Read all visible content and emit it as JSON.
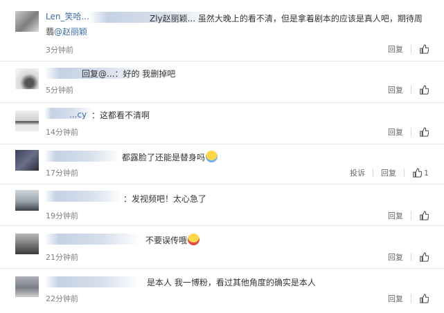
{
  "comments": [
    {
      "name": "Len_笑哈...",
      "text_prefix": "",
      "text_main": "Zly赵丽颖... 虽然大晚上的看不清，但是拿着剧本的应该是真人吧，期待周",
      "text_line2_main": "翡",
      "text_line2_at": "@赵丽颖",
      "time": "3分钟前",
      "reply": "回复",
      "like_count": ""
    },
    {
      "name": "",
      "text_main": "回复@...：好的 我删掉吧",
      "time": "5分钟前",
      "reply": "回复",
      "like_count": ""
    },
    {
      "name": "...cy",
      "text_main": "：这都看不清啊",
      "time": "14分钟前",
      "reply": "回复",
      "like_count": ""
    },
    {
      "name": "",
      "text_main": "都露脸了还能是替身吗",
      "emoji": "laughing-tears-emoji",
      "time": "17分钟前",
      "report": "投诉",
      "reply": "回复",
      "like_count": "1"
    },
    {
      "name": "",
      "text_main": "：发视频吧！太心急了",
      "time": "19分钟前",
      "reply": "回复",
      "like_count": ""
    },
    {
      "name": "",
      "text_main": "不要误传哦",
      "emoji": "blushing-emoji",
      "time": "21分钟前",
      "reply": "回复",
      "like_count": ""
    },
    {
      "name": "",
      "text_main": "是本人 我一博粉，看过其他角度的确实是本人",
      "time": "22分钟前",
      "reply": "回复",
      "like_count": ""
    }
  ],
  "colors": {
    "link": "#3c6ea8",
    "text": "#333333",
    "muted": "#808080",
    "divider": "#e9e9e9"
  }
}
